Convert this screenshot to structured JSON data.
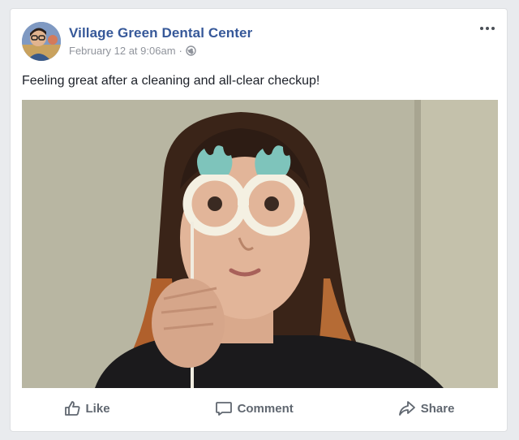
{
  "post": {
    "page_name": "Village Green Dental Center",
    "timestamp": "February 12 at 9:06am",
    "separator": "·",
    "privacy_icon": "globe-icon",
    "more_icon": "more-options-icon",
    "text": "Feeling great after a cleaning and all-clear checkup!"
  },
  "actions": {
    "like_label": "Like",
    "comment_label": "Comment",
    "share_label": "Share"
  },
  "colors": {
    "link": "#365899",
    "meta": "#90949c",
    "action": "#606770",
    "background": "#e9ebee"
  }
}
